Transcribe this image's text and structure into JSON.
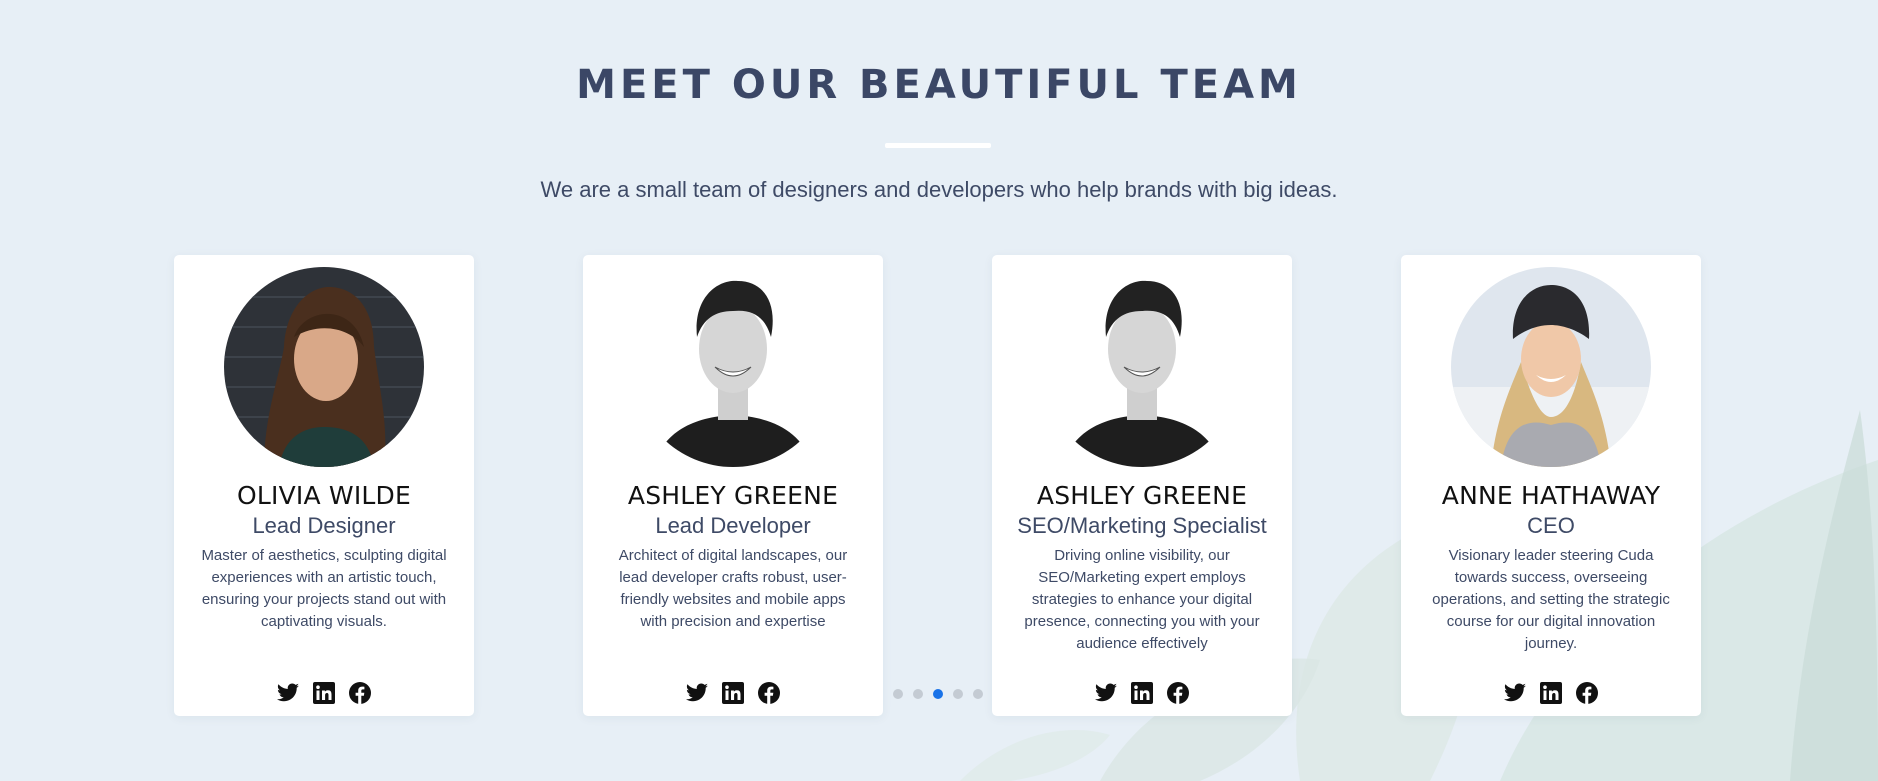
{
  "section": {
    "title": "MEET OUR BEAUTIFUL TEAM",
    "subtitle": "We are a small team of designers and developers who help brands with big ideas."
  },
  "members": [
    {
      "name": "OLIVIA WILDE",
      "role": "Lead Designer",
      "bio": "Master of aesthetics, sculpting digital experiences with an artistic touch, ensuring your projects stand out with captivating visuals.",
      "photo": "woman-dark-hair-portrait"
    },
    {
      "name": "ASHLEY GREENE",
      "role": "Lead Developer",
      "bio": "Architect of digital landscapes, our lead developer crafts robust, user-friendly websites and mobile apps with precision and expertise",
      "photo": "man-smiling-bw-portrait"
    },
    {
      "name": "ASHLEY GREENE",
      "role": "SEO/Marketing Specialist",
      "bio": "Driving online visibility, our SEO/Marketing expert employs strategies to enhance your digital presence, connecting you with your audience effectively",
      "photo": "man-smiling-bw-portrait"
    },
    {
      "name": "ANNE HATHAWAY",
      "role": "CEO",
      "bio": "Visionary leader steering Cuda towards success, overseeing operations, and setting the strategic course for our digital innovation journey.",
      "photo": "woman-beanie-portrait"
    }
  ],
  "social_icons": [
    "twitter-icon",
    "linkedin-icon",
    "facebook-icon"
  ],
  "carousel": {
    "page_count": 5,
    "active_page": 3
  },
  "colors": {
    "background": "#e7eff6",
    "heading": "#3b4766",
    "accent_dot": "#1a73e8",
    "inactive_dot": "#c4cbd3"
  }
}
